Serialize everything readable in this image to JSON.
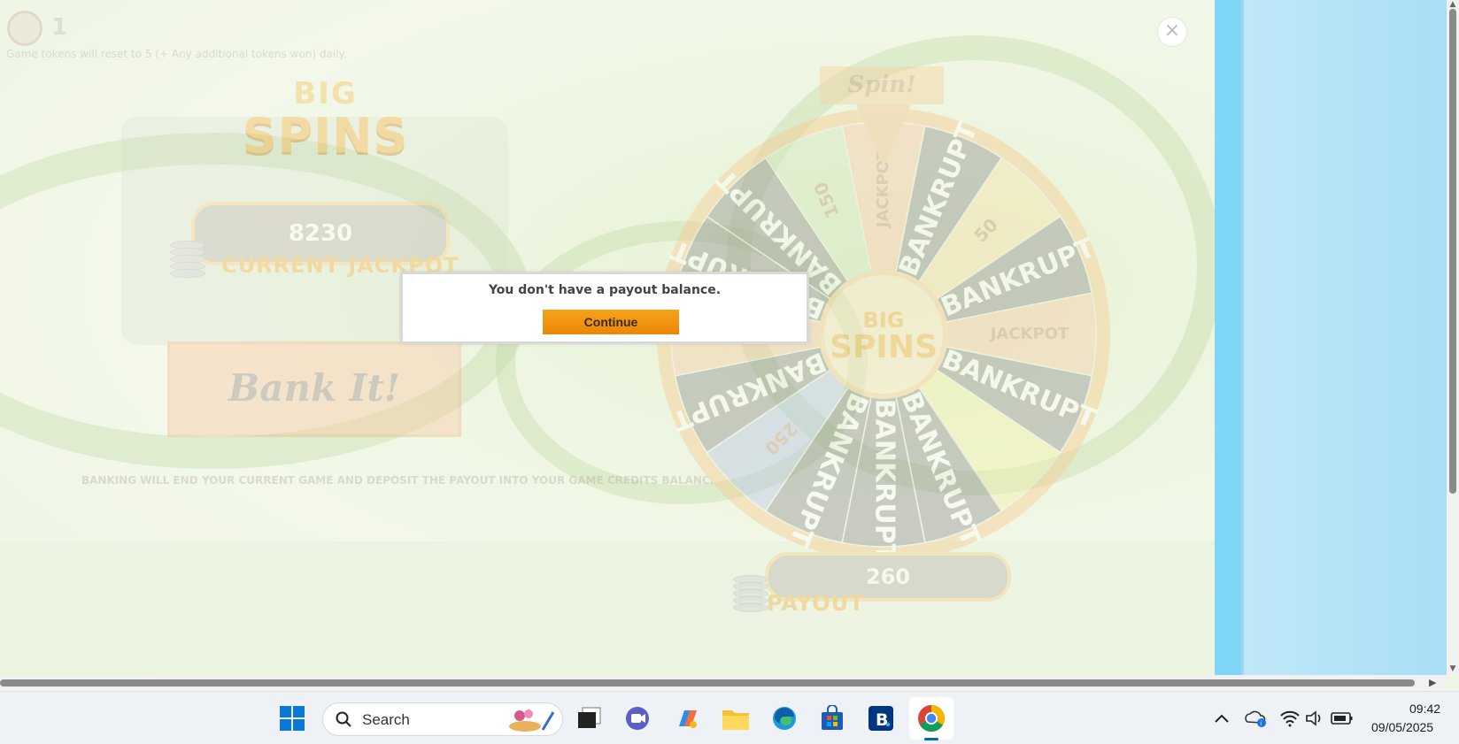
{
  "game": {
    "token_count": "1",
    "token_note": "Game tokens will reset to 5 (+ Any additional tokens won) daily.",
    "logo_line1": "BIG",
    "logo_line2": "SPINS",
    "current_jackpot_value": "8230",
    "current_jackpot_label": "CURRENT JACKPOT",
    "bank_it_label": "Bank It!",
    "bank_note": "BANKING WILL END YOUR CURRENT GAME AND DEPOSIT THE PAYOUT INTO YOUR GAME CREDITS BALANCE.",
    "spin_label": "Spin!",
    "payout_value": "260",
    "payout_label": "PAYOUT",
    "close_symbol": "×",
    "wheel_segments": [
      {
        "label": "JACKPOT",
        "color": "#f7c9a6"
      },
      {
        "label": "BANKRUPT",
        "color": "#8f8f8f"
      },
      {
        "label": "50",
        "color": "#f7e0a6"
      },
      {
        "label": "BANKRUPT",
        "color": "#8f8f8f"
      },
      {
        "label": "JACKPOT",
        "color": "#f7c9a6"
      },
      {
        "label": "BANKRUPT",
        "color": "#8f8f8f"
      },
      {
        "label": "",
        "color": "#f3f0a6"
      },
      {
        "label": "BANKRUPT",
        "color": "#8f8f8f"
      },
      {
        "label": "BANKRUPT",
        "color": "#8f8f8f"
      },
      {
        "label": "BANKRUPT",
        "color": "#8f8f8f"
      },
      {
        "label": "250",
        "color": "#b8c4e6"
      },
      {
        "label": "BANKRUPT",
        "color": "#8f8f8f"
      },
      {
        "label": "JACKPOT",
        "color": "#f7c9a6"
      },
      {
        "label": "BANKRUPT",
        "color": "#8f8f8f"
      },
      {
        "label": "BANKRUPT",
        "color": "#8f8f8f"
      },
      {
        "label": "150",
        "color": "#cfe6bd"
      }
    ],
    "wheel_hub_line1": "BIG",
    "wheel_hub_line2": "SPINS"
  },
  "dialog": {
    "message": "You don't have a payout balance.",
    "continue_label": "Continue"
  },
  "taskbar": {
    "search_label": "Search",
    "time": "09:42",
    "date": "09/05/2025",
    "apps": [
      "start-icon",
      "search-icon",
      "task-view-icon",
      "teams-icon",
      "copilot-icon",
      "file-explorer-icon",
      "edge-icon",
      "store-icon",
      "booking-icon",
      "chrome-icon"
    ],
    "tray": [
      "chevron-up-icon",
      "onedrive-icon",
      "wifi-icon",
      "volume-icon",
      "battery-icon"
    ]
  },
  "colors": {
    "accent_orange": "#f39a12",
    "jackpot_gold": "#f3b445",
    "taskbar_bg": "#eef1f5",
    "right_panel_blue": "#7fd6f7"
  }
}
